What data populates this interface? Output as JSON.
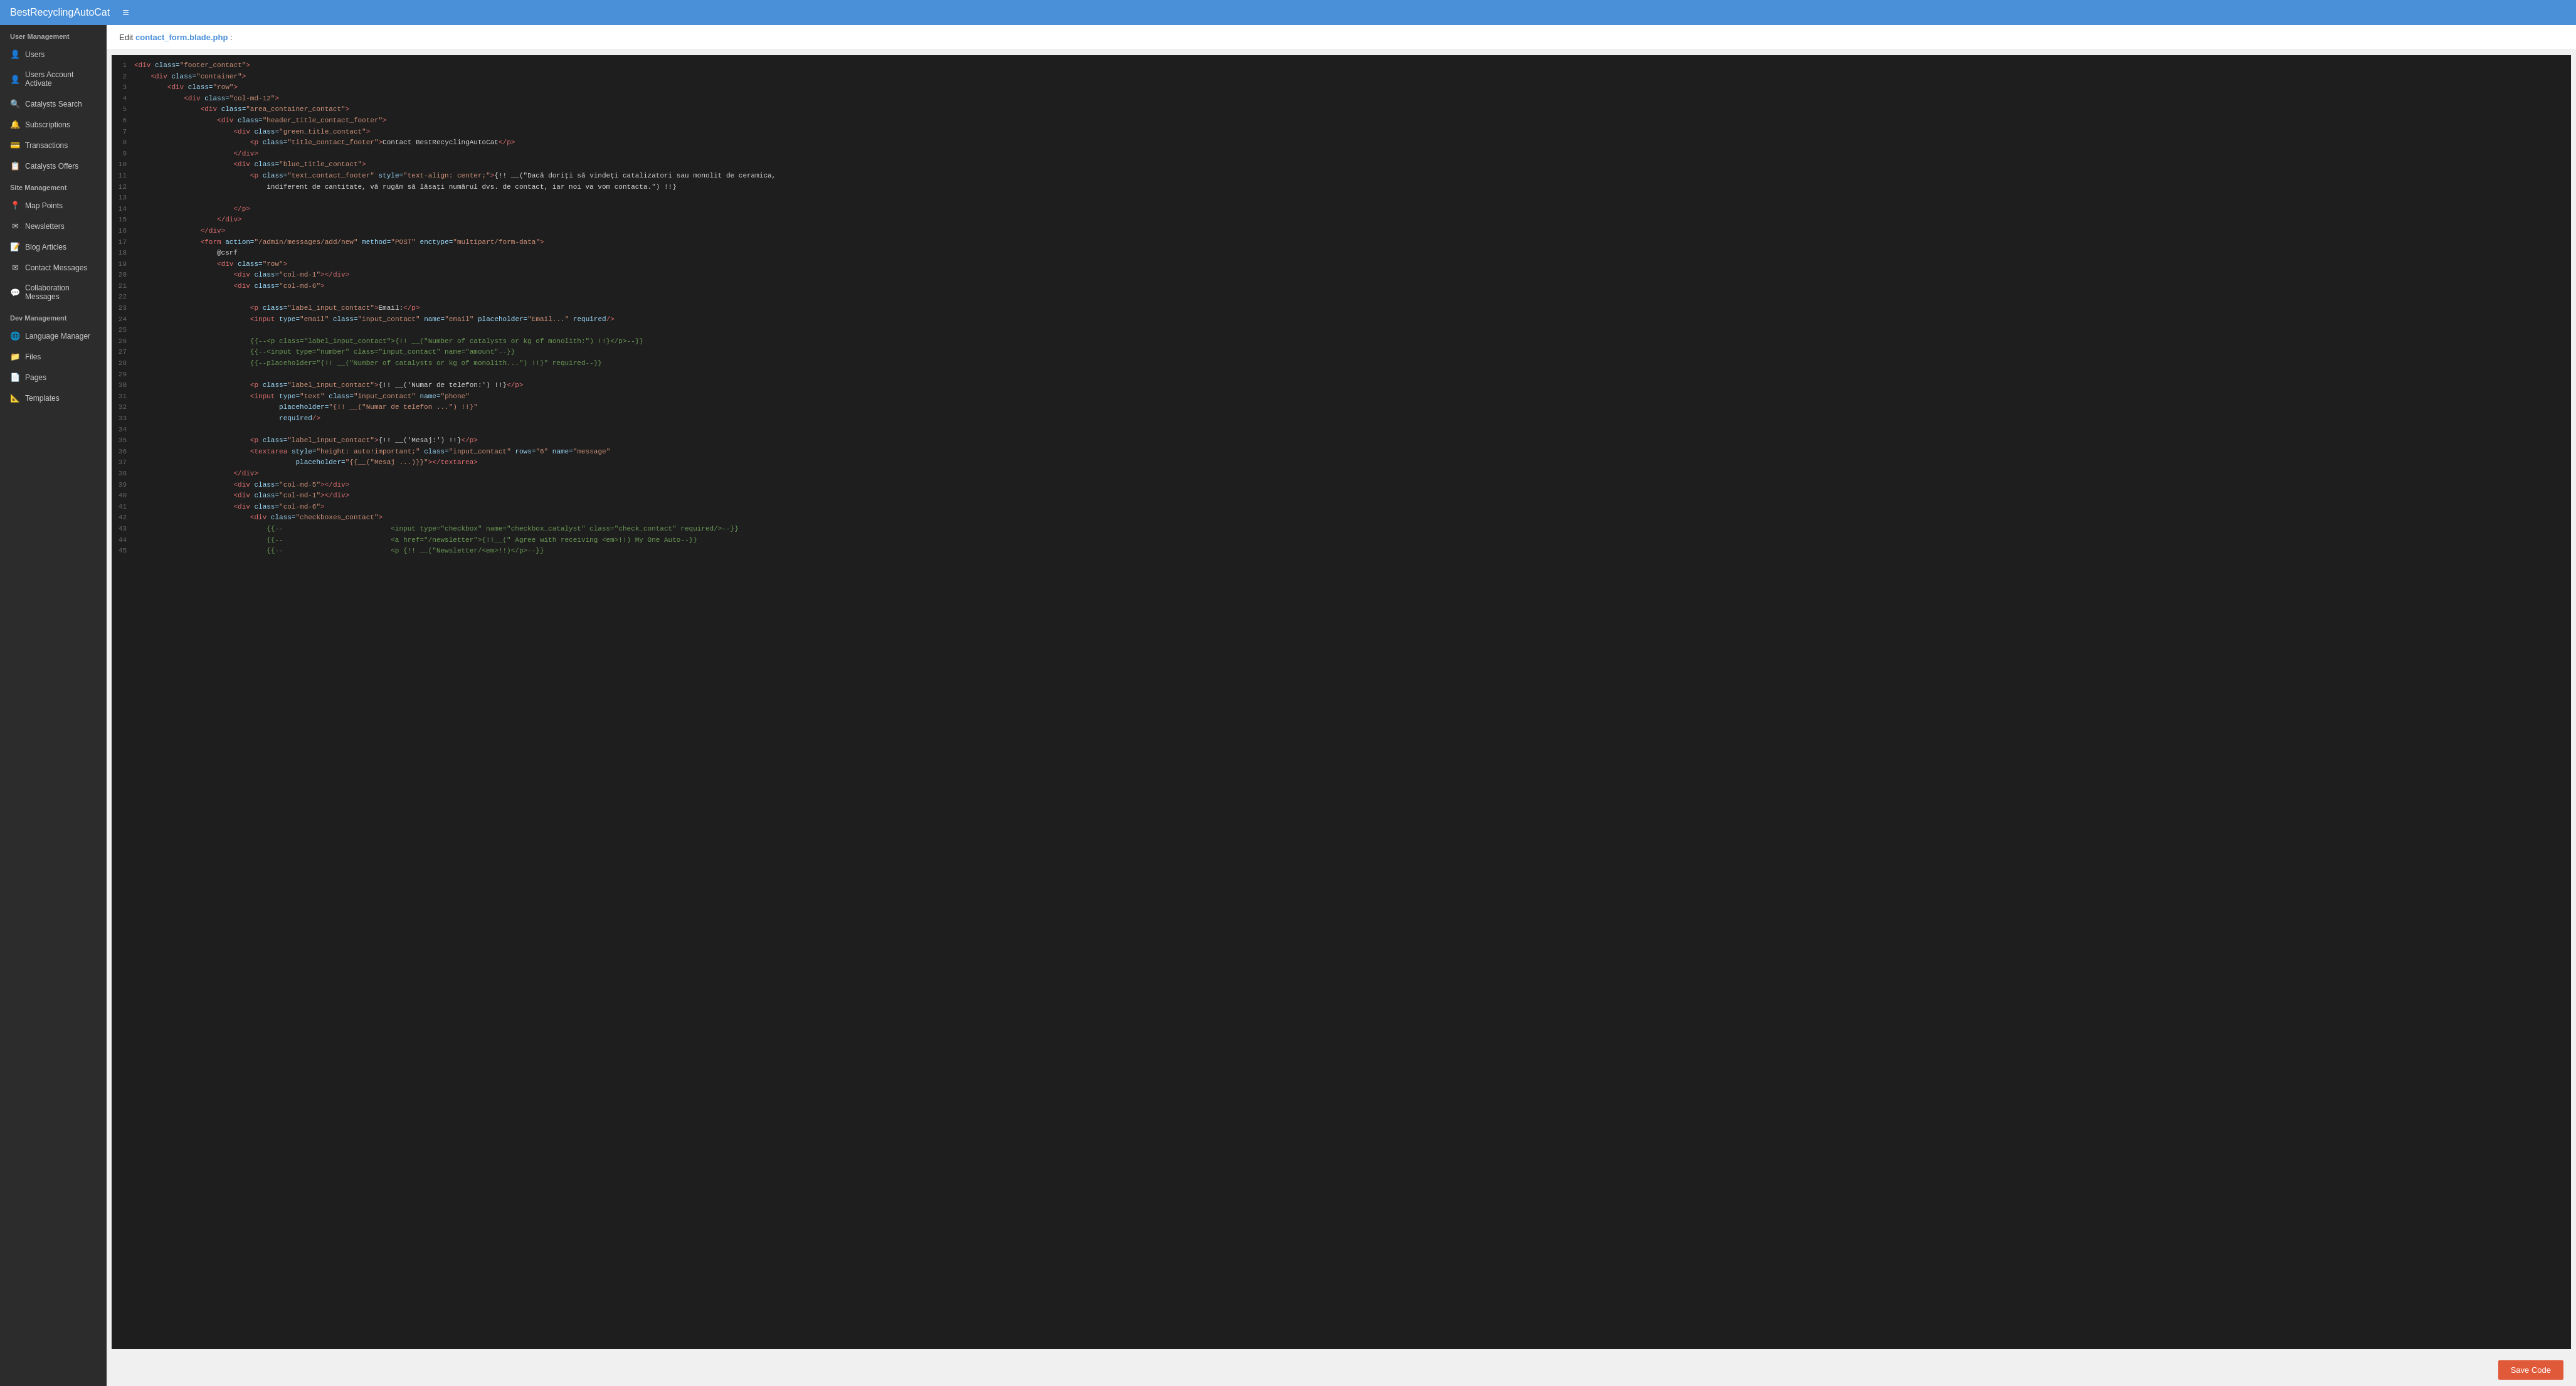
{
  "topbar": {
    "brand": "BestRecyclingAutoCat",
    "hamburger_icon": "≡"
  },
  "sidebar": {
    "sections": [
      {
        "label": "User Management",
        "items": [
          {
            "id": "users",
            "icon": "👤",
            "text": "Users"
          },
          {
            "id": "users-account-activate",
            "icon": "👤",
            "text": "Users Account Activate"
          },
          {
            "id": "catalysts-search",
            "icon": "🔍",
            "text": "Catalysts Search"
          },
          {
            "id": "subscriptions",
            "icon": "🔔",
            "text": "Subscriptions"
          },
          {
            "id": "transactions",
            "icon": "💳",
            "text": "Transactions"
          },
          {
            "id": "catalysts-offers",
            "icon": "📋",
            "text": "Catalysts Offers"
          }
        ]
      },
      {
        "label": "Site Management",
        "items": [
          {
            "id": "map-points",
            "icon": "📍",
            "text": "Map Points"
          },
          {
            "id": "newsletters",
            "icon": "✉",
            "text": "Newsletters"
          },
          {
            "id": "blog-articles",
            "icon": "📝",
            "text": "Blog Articles"
          },
          {
            "id": "contact-messages",
            "icon": "✉",
            "text": "Contact Messages"
          },
          {
            "id": "collaboration-messages",
            "icon": "💬",
            "text": "Collaboration Messages"
          }
        ]
      },
      {
        "label": "Dev Management",
        "items": [
          {
            "id": "language-manager",
            "icon": "🌐",
            "text": "Language Manager"
          },
          {
            "id": "files",
            "icon": "📁",
            "text": "Files"
          },
          {
            "id": "pages",
            "icon": "📄",
            "text": "Pages"
          },
          {
            "id": "templates",
            "icon": "📐",
            "text": "Templates"
          }
        ]
      }
    ]
  },
  "edit_bar": {
    "prefix": "Edit",
    "filename": "contact_form.blade.php",
    "suffix": ":"
  },
  "save_button": "Save Code",
  "code_lines": [
    {
      "n": 1,
      "html": "<span class='tag'>&lt;div</span> <span class='attr'>class=</span><span class='val'>\"footer_contact\"</span><span class='tag'>&gt;</span>"
    },
    {
      "n": 2,
      "html": "    <span class='tag'>&lt;div</span> <span class='attr'>class=</span><span class='val'>\"container\"</span><span class='tag'>&gt;</span>"
    },
    {
      "n": 3,
      "html": "        <span class='tag'>&lt;div</span> <span class='attr'>class=</span><span class='val'>\"row\"</span><span class='tag'>&gt;</span>"
    },
    {
      "n": 4,
      "html": "            <span class='tag'>&lt;div</span> <span class='attr'>class=</span><span class='val'>\"col-md-12\"</span><span class='tag'>&gt;</span>"
    },
    {
      "n": 5,
      "html": "                <span class='tag'>&lt;div</span> <span class='attr'>class=</span><span class='val'>\"area_container_contact\"</span><span class='tag'>&gt;</span>"
    },
    {
      "n": 6,
      "html": "                    <span class='tag'>&lt;div</span> <span class='attr'>class=</span><span class='val'>\"header_title_contact_footer\"</span><span class='tag'>&gt;</span>"
    },
    {
      "n": 7,
      "html": "                        <span class='tag'>&lt;div</span> <span class='attr'>class=</span><span class='val'>\"green_title_contact\"</span><span class='tag'>&gt;</span>"
    },
    {
      "n": 8,
      "html": "                            <span class='tag'>&lt;p</span> <span class='attr'>class=</span><span class='val'>\"title_contact_footer\"</span><span class='tag'>&gt;</span>Contact BestRecyclingAutoCat<span class='tag'>&lt;/p&gt;</span>"
    },
    {
      "n": 9,
      "html": "                        <span class='tag'>&lt;/div&gt;</span>"
    },
    {
      "n": 10,
      "html": "                        <span class='tag'>&lt;div</span> <span class='attr'>class=</span><span class='val'>\"blue_title_contact\"</span><span class='tag'>&gt;</span>"
    },
    {
      "n": 11,
      "html": "                            <span class='tag'>&lt;p</span> <span class='attr'>class=</span><span class='val'>\"text_contact_footer\"</span> <span class='attr'>style=</span><span class='val'>\"text-align: center;\"</span><span class='tag'>&gt;</span>{!! __(\"Dacă doriți să vindeți catalizatori sau monolit de ceramica,"
    },
    {
      "n": 12,
      "html": "                                indiferent de cantitate, vă rugăm să lăsați numărul dvs. de contact, iar noi va vom contacta.\") !!}"
    },
    {
      "n": 13,
      "html": ""
    },
    {
      "n": 14,
      "html": "                        <span class='tag'>&lt;/p&gt;</span>"
    },
    {
      "n": 15,
      "html": "                    <span class='tag'>&lt;/div&gt;</span>"
    },
    {
      "n": 16,
      "html": "                <span class='tag'>&lt;/div&gt;</span>"
    },
    {
      "n": 17,
      "html": "                <span class='tag'>&lt;form</span> <span class='attr'>action=</span><span class='val'>\"/admin/messages/add/new\"</span> <span class='attr'>method=</span><span class='val'>\"POST\"</span> <span class='attr'>enctype=</span><span class='val'>\"multipart/form-data\"</span><span class='tag'>&gt;</span>"
    },
    {
      "n": 18,
      "html": "                    @csrf"
    },
    {
      "n": 19,
      "html": "                    <span class='tag'>&lt;div</span> <span class='attr'>class=</span><span class='val'>\"row\"</span><span class='tag'>&gt;</span>"
    },
    {
      "n": 20,
      "html": "                        <span class='tag'>&lt;div</span> <span class='attr'>class=</span><span class='val'>\"col-md-1\"</span><span class='tag'>&gt;&lt;/div&gt;</span>"
    },
    {
      "n": 21,
      "html": "                        <span class='tag'>&lt;div</span> <span class='attr'>class=</span><span class='val'>\"col-md-6\"</span><span class='tag'>&gt;</span>"
    },
    {
      "n": 22,
      "html": ""
    },
    {
      "n": 23,
      "html": "                            <span class='tag'>&lt;p</span> <span class='attr'>class=</span><span class='val'>\"label_input_contact\"</span><span class='tag'>&gt;</span>Email:<span class='tag'>&lt;/p&gt;</span>"
    },
    {
      "n": 24,
      "html": "                            <span class='tag'>&lt;input</span> <span class='attr'>type=</span><span class='val'>\"email\"</span> <span class='attr'>class=</span><span class='val'>\"input_contact\"</span> <span class='attr'>name=</span><span class='val'>\"email\"</span> <span class='attr'>placeholder=</span><span class='val'>\"Email...\"</span> <span class='attr'>required</span><span class='tag'>/&gt;</span>"
    },
    {
      "n": 25,
      "html": ""
    },
    {
      "n": 26,
      "html": "                            <span class='comment'>{{--&lt;p class=\"label_input_contact\"&gt;{!! __(\"Number of catalysts or kg of monolith:\") !!}&lt;/p&gt;--}}</span>"
    },
    {
      "n": 27,
      "html": "                            <span class='comment'>{{--&lt;input type=\"number\" class=\"input_contact\" name=\"amount\"--}}</span>"
    },
    {
      "n": 28,
      "html": "                            <span class='comment'>{{--placeholder=\"{!! __(\"Number of catalysts or kg of monolith...\") !!}\" required--}}</span>"
    },
    {
      "n": 29,
      "html": ""
    },
    {
      "n": 30,
      "html": "                            <span class='tag'>&lt;p</span> <span class='attr'>class=</span><span class='val'>\"label_input_contact\"</span><span class='tag'>&gt;</span>{!! __('Numar de telefon:') !!}<span class='tag'>&lt;/p&gt;</span>"
    },
    {
      "n": 31,
      "html": "                            <span class='tag'>&lt;input</span> <span class='attr'>type=</span><span class='val'>\"text\"</span> <span class='attr'>class=</span><span class='val'>\"input_contact\"</span> <span class='attr'>name=</span><span class='val'>\"phone\"</span>"
    },
    {
      "n": 32,
      "html": "                                   <span class='attr'>placeholder=</span><span class='val'>\"{!! __(\"Numar de telefon ...\") !!}\"</span>"
    },
    {
      "n": 33,
      "html": "                                   <span class='attr'>required</span><span class='tag'>/&gt;</span>"
    },
    {
      "n": 34,
      "html": ""
    },
    {
      "n": 35,
      "html": "                            <span class='tag'>&lt;p</span> <span class='attr'>class=</span><span class='val'>\"label_input_contact\"</span><span class='tag'>&gt;</span>{!! __('Mesaj:') !!}<span class='tag'>&lt;/p&gt;</span>"
    },
    {
      "n": 36,
      "html": "                            <span class='tag'>&lt;textarea</span> <span class='attr'>style=</span><span class='val'>\"height: auto!important;\"</span> <span class='attr'>class=</span><span class='val'>\"input_contact\"</span> <span class='attr'>rows=</span><span class='val'>\"6\"</span> <span class='attr'>name=</span><span class='val'>\"message\"</span>"
    },
    {
      "n": 37,
      "html": "                                       <span class='attr'>placeholder=</span><span class='val'>\"{{__(\"Mesaj ...)}}\"</span><span class='tag'>&gt;&lt;/textarea&gt;</span>"
    },
    {
      "n": 38,
      "html": "                        <span class='tag'>&lt;/div&gt;</span>"
    },
    {
      "n": 39,
      "html": "                        <span class='tag'>&lt;div</span> <span class='attr'>class=</span><span class='val'>\"col-md-5\"</span><span class='tag'>&gt;&lt;/div&gt;</span>"
    },
    {
      "n": 40,
      "html": "                        <span class='tag'>&lt;div</span> <span class='attr'>class=</span><span class='val'>\"col-md-1\"</span><span class='tag'>&gt;&lt;/div&gt;</span>"
    },
    {
      "n": 41,
      "html": "                        <span class='tag'>&lt;div</span> <span class='attr'>class=</span><span class='val'>\"col-md-6\"</span><span class='tag'>&gt;</span>"
    },
    {
      "n": 42,
      "html": "                            <span class='tag'>&lt;div</span> <span class='attr'>class=</span><span class='val'>\"checkboxes_contact\"</span><span class='tag'>&gt;</span>"
    },
    {
      "n": 43,
      "html": "                                <span class='comment'>{{--                          &lt;input type=\"checkbox\" name=\"checkbox_catalyst\" class=\"check_contact\" required/&gt;--}}</span>"
    },
    {
      "n": 44,
      "html": "                                <span class='comment'>{{--                          &lt;a href=\"/newsletter\"&gt;{!!__(\" Agree with receiving &lt;em&gt;!!) My One Auto--}}</span>"
    },
    {
      "n": 45,
      "html": "                                <span class='comment'>{{--                          &lt;p {!! __(\"Newsletter/&lt;em&gt;!!)&lt;/p&gt;--}}</span>"
    }
  ]
}
